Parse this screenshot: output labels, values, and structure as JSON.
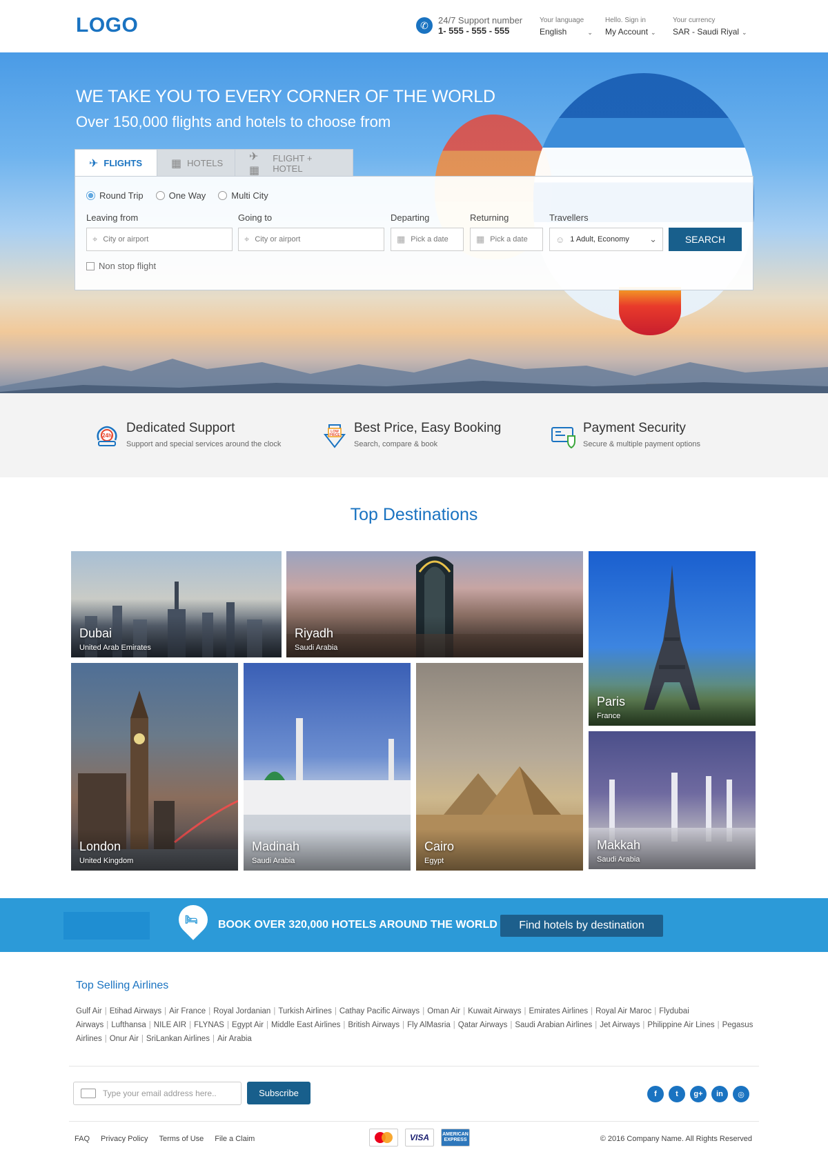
{
  "header": {
    "logo": "LOGO",
    "support_label": "24/7 Support number",
    "support_number": "1- 555 - 555 - 555",
    "language_label": "Your language",
    "language_value": "English",
    "account_label": "Hello. Sign in",
    "account_value": "My Account",
    "currency_label": "Your currency",
    "currency_value": "SAR - Saudi Riyal"
  },
  "hero": {
    "title": "WE TAKE YOU TO EVERY CORNER OF THE WORLD",
    "subtitle": "Over 150,000 flights and hotels to choose from"
  },
  "search": {
    "tabs": [
      {
        "label": "FLIGHTS",
        "icon": "plane-icon",
        "active": true
      },
      {
        "label": "HOTELS",
        "icon": "building-icon",
        "active": false
      },
      {
        "label": "FLIGHT + HOTEL",
        "icon": "plane-hotel-icon",
        "active": false
      }
    ],
    "trip_types": [
      {
        "label": "Round Trip",
        "selected": true
      },
      {
        "label": "One Way",
        "selected": false
      },
      {
        "label": "Multi City",
        "selected": false
      }
    ],
    "leaving_label": "Leaving from",
    "leaving_placeholder": "City or airport",
    "going_label": "Going to",
    "going_placeholder": "City or airport",
    "departing_label": "Departing",
    "departing_placeholder": "Pick a date",
    "returning_label": "Returning",
    "returning_placeholder": "Pick a date",
    "travellers_label": "Travellers",
    "travellers_value": "1 Adult, Economy",
    "search_button": "SEARCH",
    "nonstop_label": "Non stop flight"
  },
  "features": [
    {
      "title": "Dedicated Support",
      "subtitle": "Support and special services around the clock",
      "icon": "support-24h-icon"
    },
    {
      "title": "Best Price, Easy Booking",
      "subtitle": "Search, compare & book",
      "icon": "low-price-tag-icon"
    },
    {
      "title": "Payment Security",
      "subtitle": "Secure & multiple payment options",
      "icon": "secure-card-icon"
    }
  ],
  "destinations": {
    "title": "Top Destinations",
    "items": [
      {
        "city": "Dubai",
        "country": "United Arab Emirates"
      },
      {
        "city": "Riyadh",
        "country": "Saudi Arabia"
      },
      {
        "city": "Paris",
        "country": "France"
      },
      {
        "city": "London",
        "country": "United Kingdom"
      },
      {
        "city": "Madinah",
        "country": "Saudi Arabia"
      },
      {
        "city": "Cairo",
        "country": "Egypt"
      },
      {
        "city": "Makkah",
        "country": "Saudi Arabia"
      }
    ]
  },
  "banner": {
    "text": "BOOK OVER 320,000 HOTELS AROUND THE WORLD",
    "button": "Find hotels by destination"
  },
  "airlines": {
    "title": "Top Selling Airlines",
    "items": [
      "Gulf Air",
      "Etihad Airways",
      "Air France",
      "Royal Jordanian",
      "Turkish Airlines",
      "Cathay Pacific Airways",
      "Oman Air",
      "Kuwait Airways",
      "Emirates Airlines",
      "Royal Air Maroc",
      "Flydubai Airways",
      "Lufthansa",
      "NILE AIR",
      "FLYNAS",
      "Egypt Air",
      "Middle East Airlines",
      "British Airways",
      "Fly AlMasria",
      "Qatar Airways",
      "Saudi Arabian Airlines",
      "Jet Airways",
      "Philippine Air Lines",
      "Pegasus Airlines",
      "Onur Air",
      "SriLankan Airlines",
      "Air Arabia"
    ]
  },
  "footer": {
    "email_placeholder": "Type your email address here..",
    "subscribe": "Subscribe",
    "socials": [
      {
        "icon": "facebook-icon",
        "glyph": "f"
      },
      {
        "icon": "twitter-icon",
        "glyph": "t"
      },
      {
        "icon": "google-plus-icon",
        "glyph": "g+"
      },
      {
        "icon": "linkedin-icon",
        "glyph": "in"
      },
      {
        "icon": "instagram-icon",
        "glyph": "◎"
      }
    ],
    "links": [
      "FAQ",
      "Privacy Policy",
      "Terms of Use",
      "File a Claim"
    ],
    "cards": {
      "mastercard": "MasterCard",
      "visa": "VISA",
      "amex": "AMERICAN EXPRESS"
    },
    "copyright": "© 2016 Company Name. All Rights Reserved"
  }
}
